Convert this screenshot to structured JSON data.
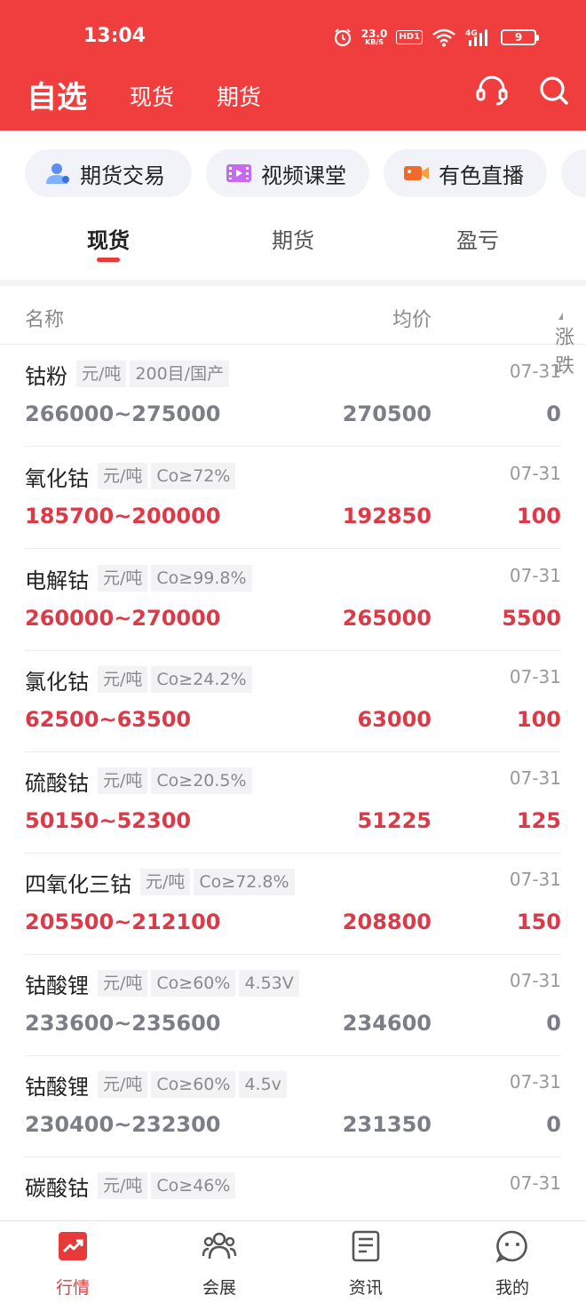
{
  "status_bar": {
    "time": "13:04",
    "net_speed_value": "23.0",
    "net_speed_unit": "KB/S",
    "hd_label": "HD1",
    "signal_label": "4G",
    "battery": "9"
  },
  "nav": {
    "title": "自选",
    "tabs": [
      {
        "label": "现货"
      },
      {
        "label": "期货"
      }
    ],
    "icons": [
      "headset-icon",
      "search-icon"
    ]
  },
  "shortcuts": [
    {
      "label": "期货交易",
      "icon": "user-icon"
    },
    {
      "label": "视频课堂",
      "icon": "video-film-icon"
    },
    {
      "label": "有色直播",
      "icon": "camera-icon"
    },
    {
      "label": "",
      "icon": "partial-chip-icon"
    }
  ],
  "sub_tabs": [
    {
      "label": "现货",
      "active": true
    },
    {
      "label": "期货",
      "active": false
    },
    {
      "label": "盈亏",
      "active": false
    }
  ],
  "columns": {
    "name": "名称",
    "avg": "均价",
    "change": "涨跌"
  },
  "rows": [
    {
      "name": "钴粉",
      "tags": [
        "元/吨",
        "200目/国产"
      ],
      "date": "07-31",
      "range": "266000~275000",
      "avg": "270500",
      "change": "0",
      "trend": "flat"
    },
    {
      "name": "氧化钴",
      "tags": [
        "元/吨",
        "Co≥72%"
      ],
      "date": "07-31",
      "range": "185700~200000",
      "avg": "192850",
      "change": "100",
      "trend": "up"
    },
    {
      "name": "电解钴",
      "tags": [
        "元/吨",
        "Co≥99.8%"
      ],
      "date": "07-31",
      "range": "260000~270000",
      "avg": "265000",
      "change": "5500",
      "trend": "up"
    },
    {
      "name": "氯化钴",
      "tags": [
        "元/吨",
        "Co≥24.2%"
      ],
      "date": "07-31",
      "range": "62500~63500",
      "avg": "63000",
      "change": "100",
      "trend": "up"
    },
    {
      "name": "硫酸钴",
      "tags": [
        "元/吨",
        "Co≥20.5%"
      ],
      "date": "07-31",
      "range": "50150~52300",
      "avg": "51225",
      "change": "125",
      "trend": "up"
    },
    {
      "name": "四氧化三钴",
      "tags": [
        "元/吨",
        "Co≥72.8%"
      ],
      "date": "07-31",
      "range": "205500~212100",
      "avg": "208800",
      "change": "150",
      "trend": "up"
    },
    {
      "name": "钴酸锂",
      "tags": [
        "元/吨",
        "Co≥60%",
        "4.53V"
      ],
      "date": "07-31",
      "range": "233600~235600",
      "avg": "234600",
      "change": "0",
      "trend": "flat"
    },
    {
      "name": "钴酸锂",
      "tags": [
        "元/吨",
        "Co≥60%",
        "4.5v"
      ],
      "date": "07-31",
      "range": "230400~232300",
      "avg": "231350",
      "change": "0",
      "trend": "flat"
    },
    {
      "name": "碳酸钴",
      "tags": [
        "元/吨",
        "Co≥46%"
      ],
      "date": "07-31",
      "range": "",
      "avg": "",
      "change": "",
      "trend": "up"
    }
  ],
  "tabbar": [
    {
      "label": "行情",
      "icon": "market-chart-icon",
      "active": true
    },
    {
      "label": "会展",
      "icon": "people-icon",
      "active": false
    },
    {
      "label": "资讯",
      "icon": "news-doc-icon",
      "active": false
    },
    {
      "label": "我的",
      "icon": "profile-face-icon",
      "active": false
    }
  ],
  "colors": {
    "brand_red": "#f03d3d",
    "price_up": "#dc3a48",
    "price_flat": "#7b7e87"
  }
}
